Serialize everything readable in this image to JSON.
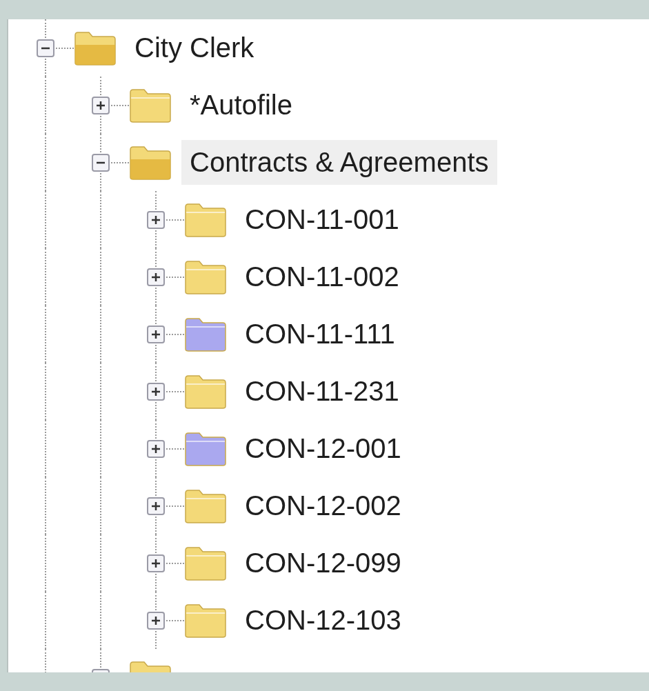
{
  "tree": [
    {
      "label": "City Clerk",
      "expanded": true,
      "selected": false,
      "color": "#f3d978",
      "children": [
        {
          "label": "*Autofile",
          "expanded": false,
          "selected": false,
          "color": "#f3d978"
        },
        {
          "label": "Contracts & Agreements",
          "expanded": true,
          "selected": true,
          "color": "#f3d978",
          "children": [
            {
              "label": "CON-11-001",
              "expanded": false,
              "selected": false,
              "color": "#f3d978"
            },
            {
              "label": "CON-11-002",
              "expanded": false,
              "selected": false,
              "color": "#f3d978"
            },
            {
              "label": "CON-11-111",
              "expanded": false,
              "selected": false,
              "color": "#aaa8ef"
            },
            {
              "label": "CON-11-231",
              "expanded": false,
              "selected": false,
              "color": "#f3d978"
            },
            {
              "label": "CON-12-001",
              "expanded": false,
              "selected": false,
              "color": "#aaa8ef"
            },
            {
              "label": "CON-12-002",
              "expanded": false,
              "selected": false,
              "color": "#f3d978"
            },
            {
              "label": "CON-12-099",
              "expanded": false,
              "selected": false,
              "color": "#f3d978"
            },
            {
              "label": "CON-12-103",
              "expanded": false,
              "selected": false,
              "color": "#f3d978"
            }
          ]
        }
      ]
    }
  ]
}
